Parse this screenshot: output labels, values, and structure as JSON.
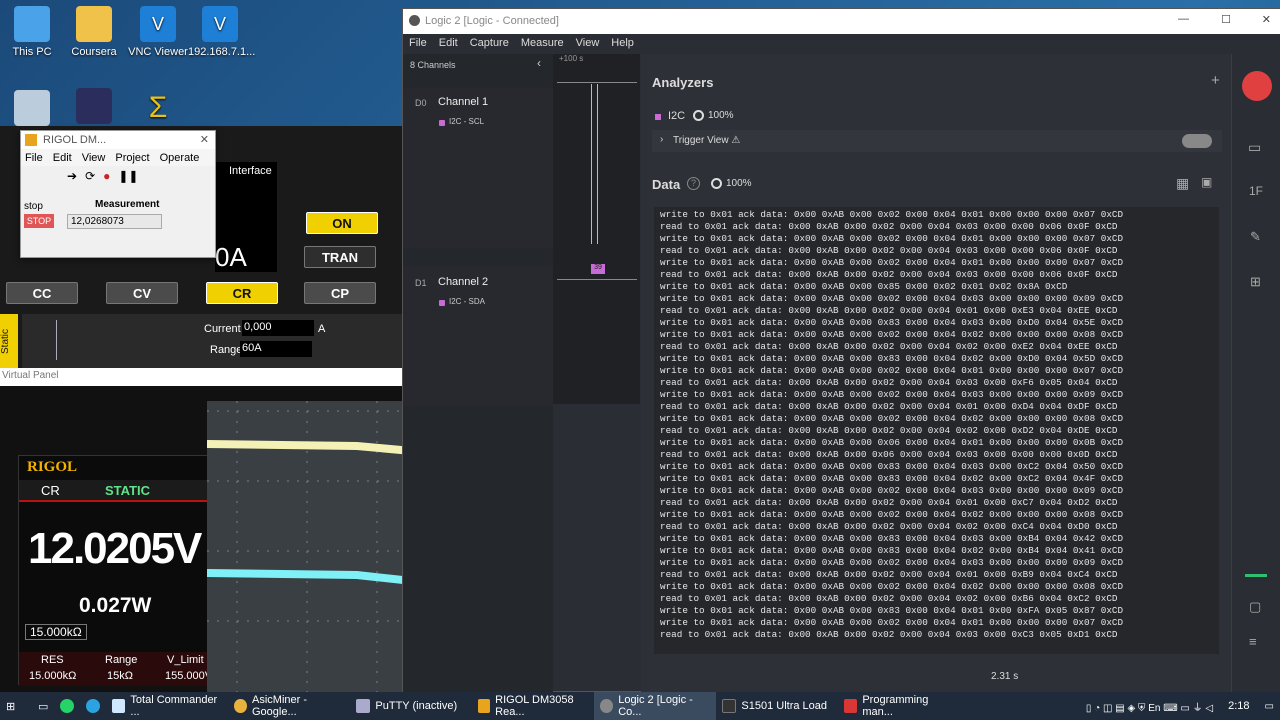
{
  "desktop": {
    "icons": [
      {
        "label": "This PC"
      },
      {
        "label": "Coursera"
      },
      {
        "label": "VNC Viewer"
      },
      {
        "label": "192.168.7.1..."
      }
    ]
  },
  "rigol_window": {
    "title": "RIGOL DM...",
    "menu": [
      "File",
      "Edit",
      "View",
      "Project",
      "Operate"
    ],
    "status": "stop",
    "stop_button": "STOP",
    "measurement_label": "Measurement",
    "measurement_value": "12,0268073"
  },
  "psu": {
    "interface_label": "Interface",
    "display_partial": "0A",
    "on_button": "ON",
    "tran_button": "TRAN",
    "modes": [
      "CC",
      "CV",
      "CR",
      "CP"
    ],
    "active_mode": "CR",
    "static_tab": "Static",
    "current_label": "Current",
    "current_value": "0,000",
    "current_unit": "A",
    "range_label": "Range",
    "range_value": "60A",
    "virtual_panel": "Virtual Panel"
  },
  "dmm": {
    "brand": "RIGOL",
    "mode": "CR",
    "state": "STATIC",
    "voltage": "12.0205V",
    "power": "0.027W",
    "resistance": "15.000kΩ",
    "col_labels": [
      "RES",
      "Range",
      "V_Limit"
    ],
    "col_values": [
      "15.000kΩ",
      "15kΩ",
      "155.000V"
    ]
  },
  "logic": {
    "title": "Logic 2 [Logic - Connected]",
    "menu": [
      "File",
      "Edit",
      "Capture",
      "Measure",
      "View",
      "Help"
    ],
    "channels_count": "8 Channels",
    "time_marker": "+100 s",
    "channels": [
      {
        "id": "D0",
        "name": "Channel 1",
        "tag": "I2C - SCL"
      },
      {
        "id": "D1",
        "name": "Channel 2",
        "tag": "I2C - SDA"
      }
    ],
    "wave_marker": "39",
    "analyzers_title": "Analyzers",
    "analyzer_name": "I2C",
    "analyzer_pct": "100%",
    "trigger_view": "Trigger View ⚠",
    "data_title": "Data",
    "data_pct": "100%",
    "duration": "2.31 s",
    "data_lines": [
      "write to 0x01 ack data: 0x00 0xAB 0x00 0x02 0x00 0x04 0x01 0x00 0x00 0x00 0x07 0xCD",
      "read to 0x01 ack data: 0x00 0xAB 0x00 0x02 0x00 0x04 0x03 0x00 0x00 0x06 0x0F 0xCD",
      "write to 0x01 ack data: 0x00 0xAB 0x00 0x02 0x00 0x04 0x01 0x00 0x00 0x00 0x07 0xCD",
      "read to 0x01 ack data: 0x00 0xAB 0x00 0x02 0x00 0x04 0x03 0x00 0x00 0x06 0x0F 0xCD",
      "write to 0x01 ack data: 0x00 0xAB 0x00 0x02 0x00 0x04 0x01 0x00 0x00 0x00 0x07 0xCD",
      "read to 0x01 ack data: 0x00 0xAB 0x00 0x02 0x00 0x04 0x03 0x00 0x00 0x06 0x0F 0xCD",
      "write to 0x01 ack data: 0x00 0xAB 0x00 0x85 0x00 0x02 0x01 0x02 0x8A 0xCD",
      "write to 0x01 ack data: 0x00 0xAB 0x00 0x02 0x00 0x04 0x03 0x00 0x00 0x00 0x09 0xCD",
      "read to 0x01 ack data: 0x00 0xAB 0x00 0x02 0x00 0x04 0x01 0x00 0xE3 0x04 0xEE 0xCD",
      "write to 0x01 ack data: 0x00 0xAB 0x00 0x83 0x00 0x04 0x03 0x00 0xD0 0x04 0x5E 0xCD",
      "write to 0x01 ack data: 0x00 0xAB 0x00 0x02 0x00 0x04 0x02 0x00 0x00 0x00 0x08 0xCD",
      "read to 0x01 ack data: 0x00 0xAB 0x00 0x02 0x00 0x04 0x02 0x00 0xE2 0x04 0xEE 0xCD",
      "write to 0x01 ack data: 0x00 0xAB 0x00 0x83 0x00 0x04 0x02 0x00 0xD0 0x04 0x5D 0xCD",
      "write to 0x01 ack data: 0x00 0xAB 0x00 0x02 0x00 0x04 0x01 0x00 0x00 0x00 0x07 0xCD",
      "read to 0x01 ack data: 0x00 0xAB 0x00 0x02 0x00 0x04 0x03 0x00 0xF6 0x05 0x04 0xCD",
      "write to 0x01 ack data: 0x00 0xAB 0x00 0x02 0x00 0x04 0x03 0x00 0x00 0x00 0x09 0xCD",
      "read to 0x01 ack data: 0x00 0xAB 0x00 0x02 0x00 0x04 0x01 0x00 0xD4 0x04 0xDF 0xCD",
      "write to 0x01 ack data: 0x00 0xAB 0x00 0x02 0x00 0x04 0x02 0x00 0x00 0x00 0x08 0xCD",
      "read to 0x01 ack data: 0x00 0xAB 0x00 0x02 0x00 0x04 0x02 0x00 0xD2 0x04 0xDE 0xCD",
      "write to 0x01 ack data: 0x00 0xAB 0x00 0x06 0x00 0x04 0x01 0x00 0x00 0x00 0x0B 0xCD",
      "read to 0x01 ack data: 0x00 0xAB 0x00 0x06 0x00 0x04 0x03 0x00 0x00 0x00 0x0D 0xCD",
      "write to 0x01 ack data: 0x00 0xAB 0x00 0x83 0x00 0x04 0x03 0x00 0xC2 0x04 0x50 0xCD",
      "write to 0x01 ack data: 0x00 0xAB 0x00 0x83 0x00 0x04 0x02 0x00 0xC2 0x04 0x4F 0xCD",
      "write to 0x01 ack data: 0x00 0xAB 0x00 0x02 0x00 0x04 0x03 0x00 0x00 0x00 0x09 0xCD",
      "read to 0x01 ack data: 0x00 0xAB 0x00 0x02 0x00 0x04 0x01 0x00 0xC7 0x04 0xD2 0xCD",
      "write to 0x01 ack data: 0x00 0xAB 0x00 0x02 0x00 0x04 0x02 0x00 0x00 0x00 0x08 0xCD",
      "read to 0x01 ack data: 0x00 0xAB 0x00 0x02 0x00 0x04 0x02 0x00 0xC4 0x04 0xD0 0xCD",
      "write to 0x01 ack data: 0x00 0xAB 0x00 0x83 0x00 0x04 0x03 0x00 0xB4 0x04 0x42 0xCD",
      "write to 0x01 ack data: 0x00 0xAB 0x00 0x83 0x00 0x04 0x02 0x00 0xB4 0x04 0x41 0xCD",
      "write to 0x01 ack data: 0x00 0xAB 0x00 0x02 0x00 0x04 0x03 0x00 0x00 0x00 0x09 0xCD",
      "read to 0x01 ack data: 0x00 0xAB 0x00 0x02 0x00 0x04 0x01 0x00 0xB9 0x04 0xC4 0xCD",
      "write to 0x01 ack data: 0x00 0xAB 0x00 0x02 0x00 0x04 0x02 0x00 0x00 0x00 0x08 0xCD",
      "read to 0x01 ack data: 0x00 0xAB 0x00 0x02 0x00 0x04 0x02 0x00 0xB6 0x04 0xC2 0xCD",
      "write to 0x01 ack data: 0x00 0xAB 0x00 0x83 0x00 0x04 0x01 0x00 0xFA 0x05 0x87 0xCD",
      "write to 0x01 ack data: 0x00 0xAB 0x00 0x02 0x00 0x04 0x01 0x00 0x00 0x00 0x07 0xCD",
      "read to 0x01 ack data: 0x00 0xAB 0x00 0x02 0x00 0x04 0x03 0x00 0xC3 0x05 0xD1 0xCD"
    ]
  },
  "taskbar": {
    "items": [
      {
        "label": "Total Commander ..."
      },
      {
        "label": "AsicMiner - Google..."
      },
      {
        "label": "PuTTY (inactive)"
      },
      {
        "label": "RIGOL DM3058 Rea..."
      },
      {
        "label": "Logic 2 [Logic - Co..."
      },
      {
        "label": "S1501 Ultra Load"
      },
      {
        "label": "Programming man..."
      }
    ],
    "clock": "2:18"
  },
  "colors": {
    "logic_bg": "#2d3036",
    "channel_tag": "#c96bd6",
    "psu_active": "#f0d000",
    "dmm_accent": "#f3b400",
    "trace_yellow": "#f4f1b6",
    "trace_cyan": "#7ff0f5"
  }
}
